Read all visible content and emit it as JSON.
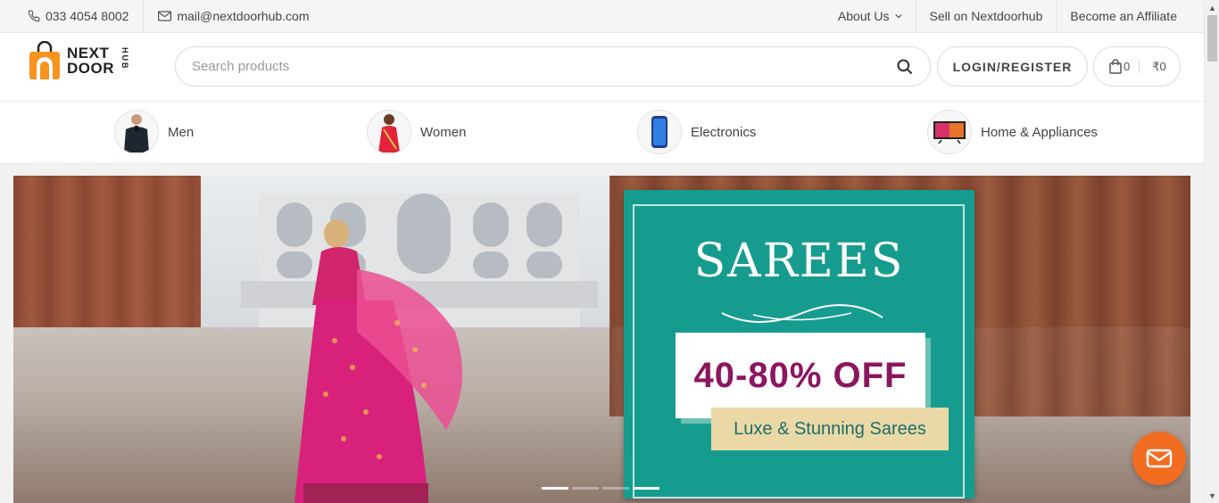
{
  "topbar": {
    "phone": "033 4054 8002",
    "email": "mail@nextdoorhub.com",
    "links": [
      {
        "label": "About Us",
        "has_dropdown": true
      },
      {
        "label": "Sell on Nextdoorhub"
      },
      {
        "label": "Become an Affiliate"
      }
    ]
  },
  "header": {
    "logo_line1": "NEXT",
    "logo_line2": "DOOR",
    "logo_hub": "HUB",
    "search_placeholder": "Search products",
    "login_label": "LOGIN/REGISTER",
    "cart_count": "0",
    "cart_total": "₹0"
  },
  "categories": [
    {
      "label": "Men",
      "icon": "man-shirt"
    },
    {
      "label": "Women",
      "icon": "woman-saree"
    },
    {
      "label": "Electronics",
      "icon": "smartphone"
    },
    {
      "label": "Home & Appliances",
      "icon": "television"
    }
  ],
  "banner": {
    "title": "SAREES",
    "discount": "40-80% OFF",
    "subtitle": "Luxe & Stunning Sarees",
    "slides": 4,
    "active_slide": 1
  },
  "colors": {
    "accent": "#f26c22",
    "promo_bg": "#169c8f",
    "discount_text": "#8c1560"
  }
}
